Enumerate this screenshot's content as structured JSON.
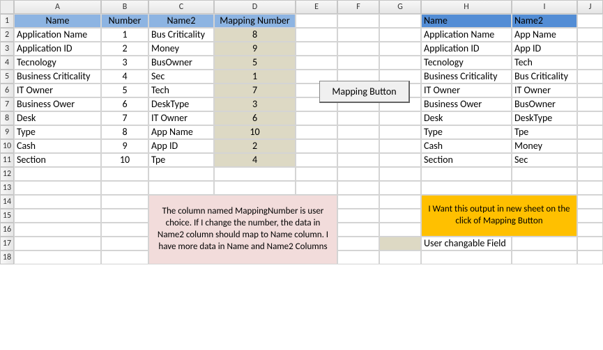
{
  "cols": [
    "A",
    "B",
    "C",
    "D",
    "E",
    "F",
    "G",
    "H",
    "I",
    "J"
  ],
  "rowCount": 18,
  "headers": {
    "a": "Name",
    "b": "Number",
    "c": "Name2",
    "d": "Mapping Number",
    "h": "Name",
    "i": "Name2"
  },
  "rows": [
    {
      "a": "Application Name",
      "b": "1",
      "c": "Bus Criticality",
      "d": "8",
      "h": "Application Name",
      "i": "App Name"
    },
    {
      "a": "Application ID",
      "b": "2",
      "c": "Money",
      "d": "9",
      "h": "Application ID",
      "i": "App ID"
    },
    {
      "a": "Tecnology",
      "b": "3",
      "c": "BusOwner",
      "d": "5",
      "h": "Tecnology",
      "i": "Tech"
    },
    {
      "a": "Business Criticality",
      "b": "4",
      "c": "Sec",
      "d": "1",
      "h": "Business Criticality",
      "i": "Bus Criticality"
    },
    {
      "a": "IT Owner",
      "b": "5",
      "c": "Tech",
      "d": "7",
      "h": "IT Owner",
      "i": "IT Owner"
    },
    {
      "a": "Business Ower",
      "b": "6",
      "c": "DeskType",
      "d": "3",
      "h": "Business Ower",
      "i": "BusOwner"
    },
    {
      "a": "Desk",
      "b": "7",
      "c": "IT Owner",
      "d": "6",
      "h": "Desk",
      "i": "DeskType"
    },
    {
      "a": "Type",
      "b": "8",
      "c": "App Name",
      "d": "10",
      "h": "Type",
      "i": "Tpe"
    },
    {
      "a": "Cash",
      "b": "9",
      "c": "App ID",
      "d": "2",
      "h": "Cash",
      "i": "Money"
    },
    {
      "a": "Section",
      "b": "10",
      "c": "Tpe",
      "d": "4",
      "h": "Section",
      "i": "Sec"
    }
  ],
  "note1": "The column named MappingNumber is user choice. If I change the number, the data in Name2 column should map to Name column.  I have more data in Name and Name2 Columns",
  "note2": "I Want this output in new sheet on the click of Mapping Button",
  "legend": "User changable  Field",
  "button": "Mapping Button"
}
